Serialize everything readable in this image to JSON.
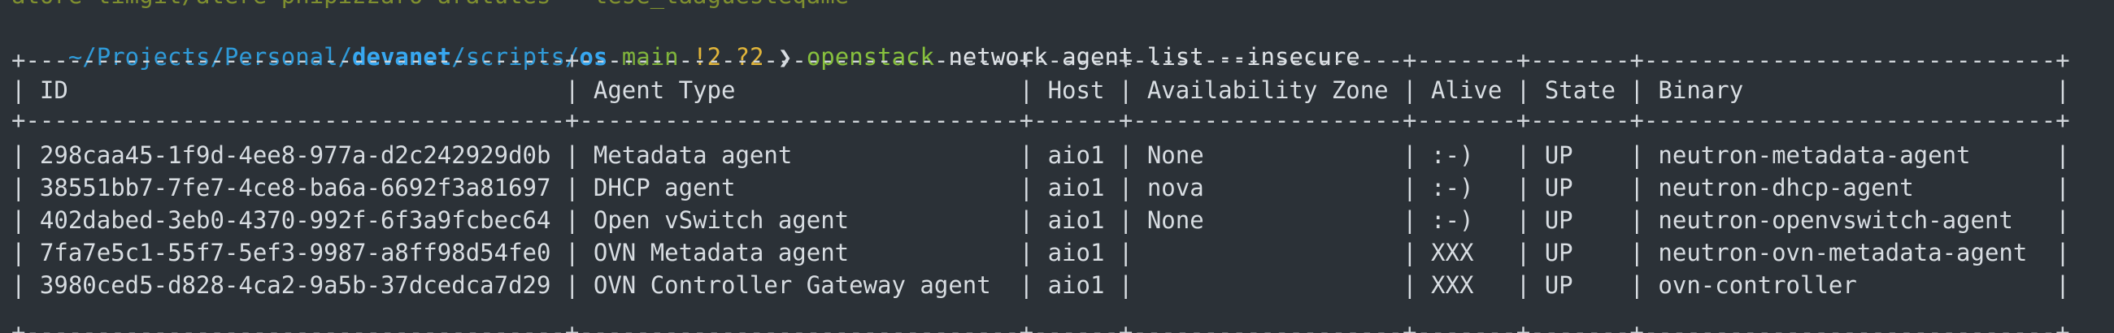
{
  "terminal": {
    "cut_line": "atore timgit/atere phipizzaro aratutes - tese_taaguesteqame",
    "prompt": {
      "path_prefix": "~/Projects/Personal/",
      "path_repo": "devanet",
      "path_mid": "/scripts/",
      "path_dir": "os",
      "branch": "main",
      "status": "!2 ?2",
      "caret": "❯",
      "command": "openstack",
      "args": "network agent list --insecure"
    },
    "table": {
      "border": "+--------------------------------------+-------------------------------+------+-------------------+-------+-------+-----------------------------+",
      "headers": [
        "ID",
        "Agent Type",
        "Host",
        "Availability Zone",
        "Alive",
        "State",
        "Binary"
      ],
      "rows": [
        [
          "298caa45-1f9d-4ee8-977a-d2c242929d0b",
          "Metadata agent",
          "aio1",
          "None",
          ":-)",
          "UP",
          "neutron-metadata-agent"
        ],
        [
          "38551bb7-7fe7-4ce8-ba6a-6692f3a81697",
          "DHCP agent",
          "aio1",
          "nova",
          ":-)",
          "UP",
          "neutron-dhcp-agent"
        ],
        [
          "402dabed-3eb0-4370-992f-6f3a9fcbec64",
          "Open vSwitch agent",
          "aio1",
          "None",
          ":-)",
          "UP",
          "neutron-openvswitch-agent"
        ],
        [
          "7fa7e5c1-55f7-5ef3-9987-a8ff98d54fe0",
          "OVN Metadata agent",
          "aio1",
          "",
          "XXX",
          "UP",
          "neutron-ovn-metadata-agent"
        ],
        [
          "3980ced5-d828-4ca2-9a5b-37dcedca7d29",
          "OVN Controller Gateway agent",
          "aio1",
          "",
          "XXX",
          "UP",
          "ovn-controller"
        ]
      ]
    }
  }
}
